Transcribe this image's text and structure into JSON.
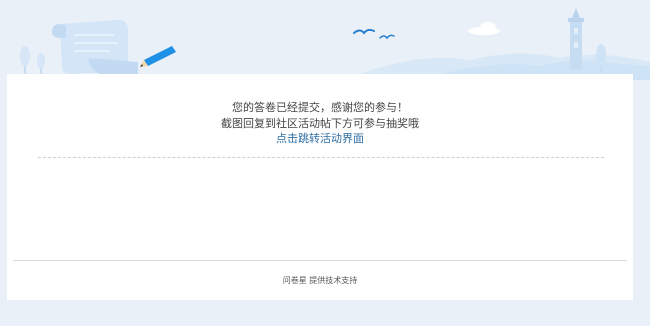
{
  "message": {
    "line1": "您的答卷已经提交，感谢您的参与！",
    "line2": "截图回复到社区活动帖下方可参与抽奖哦",
    "link_text": "点击跳转活动界面"
  },
  "footer": {
    "brand": "问卷星",
    "suffix": "提供技术支持"
  },
  "colors": {
    "page_bg": "#e9f0f8",
    "card_bg": "#ffffff",
    "link": "#2f6ea3",
    "banner_blue": "#1e90e6",
    "banner_light": "#cfe3f6"
  },
  "icons": {
    "paper_scroll": "paper-scroll-icon",
    "pencil": "pencil-icon",
    "birds": "birds-icon",
    "cloud": "cloud-icon",
    "tower": "tower-icon",
    "trees": "tree-icon"
  }
}
